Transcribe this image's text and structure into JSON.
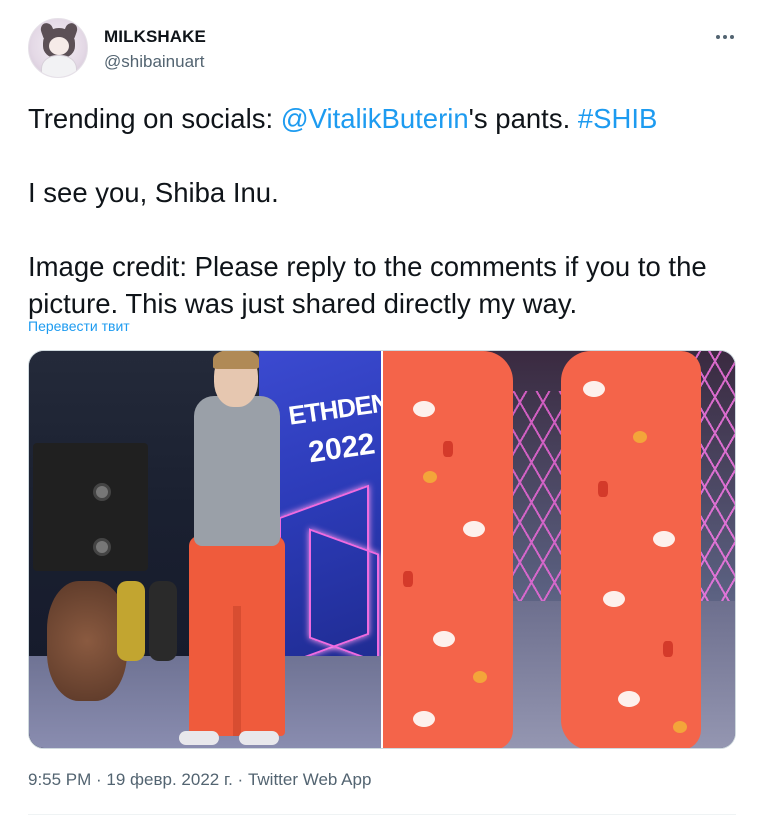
{
  "author": {
    "name": "MILKSHAKE",
    "handle": "@shibainuart"
  },
  "tweet": {
    "line1_prefix": "Trending on socials: ",
    "line1_mention": "@VitalikButerin",
    "line1_middle": "'s pants. ",
    "line1_hashtag": "#SHIB",
    "line2": "I see you, Shiba Inu.",
    "line3": "Image credit: Please reply to the comments if you to the picture. This was just shared directly my way.",
    "translate_label": "Перевести твит"
  },
  "media": {
    "screen_line1": "ETHDENVER",
    "screen_line2": "2022"
  },
  "footer": {
    "time": "9:55 PM",
    "sep1": " · ",
    "date": "19 февр. 2022 г.",
    "sep2": " · ",
    "app": "Twitter Web App"
  },
  "colors": {
    "link": "#1d9bf0",
    "text": "#0f1419",
    "secondary": "#536471"
  },
  "icons": {
    "more": "more-dots-icon"
  }
}
